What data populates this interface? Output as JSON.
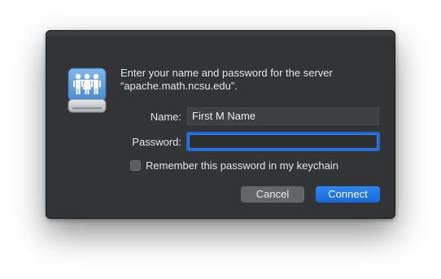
{
  "dialog": {
    "message_line1": "Enter your name and password for the server",
    "message_line2": "“apache.math.ncsu.edu”.",
    "name_label": "Name:",
    "name_value": "First M Name",
    "password_label": "Password:",
    "password_value": "",
    "remember_label": "Remember this password in my keychain",
    "remember_checked": false,
    "cancel_label": "Cancel",
    "connect_label": "Connect",
    "icon": "network-server-icon"
  },
  "colors": {
    "dialog_background": "#323436",
    "accent": "#1f6ad3",
    "default_button": "#2477e4"
  }
}
